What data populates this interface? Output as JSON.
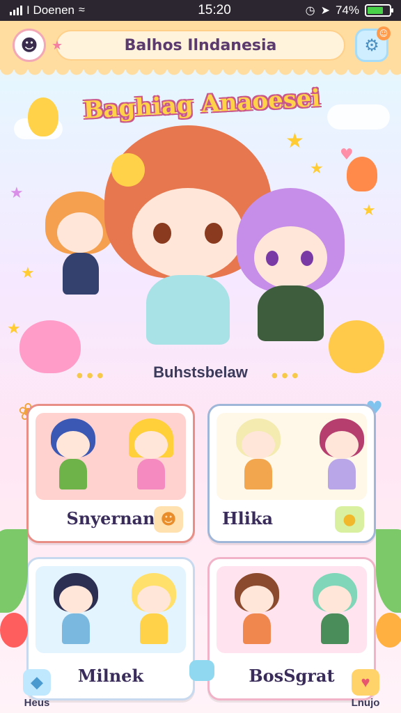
{
  "status_bar": {
    "carrier": "I Doenen",
    "time": "15:20",
    "battery": "74%",
    "battery_level": 0.74
  },
  "header": {
    "title": "Balhos Ilndanesia"
  },
  "hero": {
    "title": "Baghiag Anaoesei",
    "subtitle": "Buhstsbelaw"
  },
  "cards": [
    {
      "name": "Snyernan"
    },
    {
      "name": "Hlika"
    },
    {
      "name": "Milnek"
    },
    {
      "name": "BosSgrat"
    }
  ],
  "bottom_nav": {
    "left_label": "Heus",
    "right_label": "Lnujo"
  },
  "colors": {
    "header_bg": "#ffdca0",
    "accent_pink": "#f57fa2",
    "title_yellow": "#ffd24a"
  }
}
